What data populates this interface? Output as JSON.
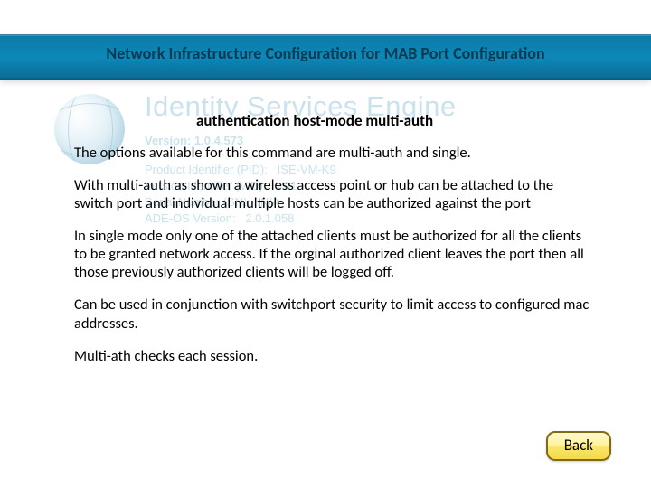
{
  "header": {
    "title": "Network Infrastructure Configuration for MAB Port Configuration"
  },
  "ise": {
    "product_name": "Identity Services Engine",
    "version_label": "Version:",
    "version_value": "1.0.4.573",
    "pid_label": "Product Identifier (PID):",
    "pid_value": "ISE-VM-K9",
    "vid_label": "Version Identifier (VID):",
    "vid_value": "V01",
    "sn_label": "Serial Number (SN):",
    "sn_value": "N/A",
    "ade_label": "ADE-OS Version:",
    "ade_value": "2.0.1.058"
  },
  "body": {
    "command": "authentication  host-mode multi-auth",
    "p1": "The options available for this command are multi-auth and single.",
    "p2": "With multi-auth as shown a wireless access point or hub can be attached to the switch port and individual multiple hosts can be authorized against the port",
    "p3": "In single mode only one of the attached clients must be authorized for all the clients to be granted network access. If the orginal authorized client leaves the port then all those previously authorized clients will be  logged off.",
    "p4": "Can be used in conjunction with switchport security to limit access to  configured mac addresses.",
    "p5": "Multi-ath checks each session."
  },
  "buttons": {
    "back": "Back"
  }
}
